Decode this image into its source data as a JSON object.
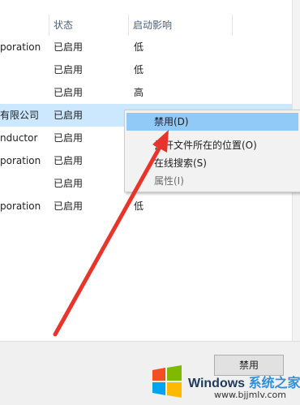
{
  "columns": {
    "status": "状态",
    "impact": "启动影响"
  },
  "rows": [
    {
      "publisher": "poration",
      "status": "已启用",
      "impact": "低",
      "selected": false
    },
    {
      "publisher": "",
      "status": "已启用",
      "impact": "低",
      "selected": false
    },
    {
      "publisher": "",
      "status": "已启用",
      "impact": "高",
      "selected": false
    },
    {
      "publisher": "有限公司",
      "status": "已启用",
      "impact": "",
      "selected": true
    },
    {
      "publisher": "nductor",
      "status": "已启用",
      "impact": "",
      "selected": false
    },
    {
      "publisher": "poration",
      "status": "已启用",
      "impact": "",
      "selected": false
    },
    {
      "publisher": "",
      "status": "已启用",
      "impact": "",
      "selected": false
    },
    {
      "publisher": "poration",
      "status": "已启用",
      "impact": "低",
      "selected": false
    }
  ],
  "context_menu": {
    "disable": "禁用(D)",
    "open_location": "打开文件所在的位置(O)",
    "search_online": "在线搜索(S)",
    "properties": "属性(I)"
  },
  "footer": {
    "button_label": "禁用"
  },
  "watermark": {
    "brand_a": "Windows",
    "brand_b": "系统之家",
    "url": "www.bjjmlv.com"
  },
  "colors": {
    "selected_row": "#cce8ff",
    "menu_highlight": "#91c9f7",
    "arrow": "#e8352c"
  }
}
